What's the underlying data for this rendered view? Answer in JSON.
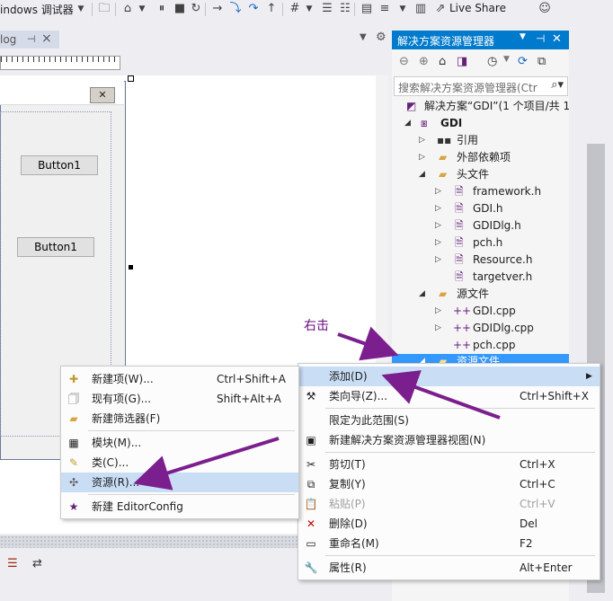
{
  "toolbar": {
    "debugger_label": "indows 调试器",
    "live_share": "Live Share"
  },
  "document_tab": {
    "label": "log"
  },
  "dialog": {
    "close_symbol": "✕",
    "button_a": "Button1",
    "button_b": "Button1"
  },
  "solution_explorer": {
    "title": "解决方案资源管理器",
    "search_placeholder": "搜索解决方案资源管理器(Ctr",
    "tree": [
      {
        "label": "解决方案“GDI”(1 个项目/共 1"
      },
      {
        "label": "GDI"
      },
      {
        "label": "引用"
      },
      {
        "label": "外部依赖项"
      },
      {
        "label": "头文件"
      },
      {
        "label": "framework.h"
      },
      {
        "label": "GDI.h"
      },
      {
        "label": "GDIDlg.h"
      },
      {
        "label": "pch.h"
      },
      {
        "label": "Resource.h"
      },
      {
        "label": "targetver.h"
      },
      {
        "label": "源文件"
      },
      {
        "label": "GDI.cpp"
      },
      {
        "label": "GDIDlg.cpp"
      },
      {
        "label": "pch.cpp"
      },
      {
        "label": "资源文件"
      }
    ]
  },
  "context_menu": {
    "items": [
      {
        "label": "添加(D)",
        "shortcut": ""
      },
      {
        "label": "类向导(Z)...",
        "shortcut": "Ctrl+Shift+X"
      },
      {
        "label": "限定为此范围(S)",
        "shortcut": ""
      },
      {
        "label": "新建解决方案资源管理器视图(N)",
        "shortcut": ""
      },
      {
        "label": "剪切(T)",
        "shortcut": "Ctrl+X"
      },
      {
        "label": "复制(Y)",
        "shortcut": "Ctrl+C"
      },
      {
        "label": "粘贴(P)",
        "shortcut": "Ctrl+V"
      },
      {
        "label": "删除(D)",
        "shortcut": "Del"
      },
      {
        "label": "重命名(M)",
        "shortcut": "F2"
      },
      {
        "label": "属性(R)",
        "shortcut": "Alt+Enter"
      }
    ]
  },
  "submenu": {
    "items": [
      {
        "label": "新建项(W)...",
        "shortcut": "Ctrl+Shift+A"
      },
      {
        "label": "现有项(G)...",
        "shortcut": "Shift+Alt+A"
      },
      {
        "label": "新建筛选器(F)",
        "shortcut": ""
      },
      {
        "label": "模块(M)...",
        "shortcut": ""
      },
      {
        "label": "类(C)...",
        "shortcut": ""
      },
      {
        "label": "资源(R)...",
        "shortcut": ""
      },
      {
        "label": "新建 EditorConfig",
        "shortcut": ""
      }
    ]
  },
  "annotation": {
    "text": "右击",
    "color": "#7b1f8f"
  },
  "colors": {
    "accent": "#007acc",
    "selection": "#3399ff",
    "menu_highlight": "#c9def5"
  }
}
